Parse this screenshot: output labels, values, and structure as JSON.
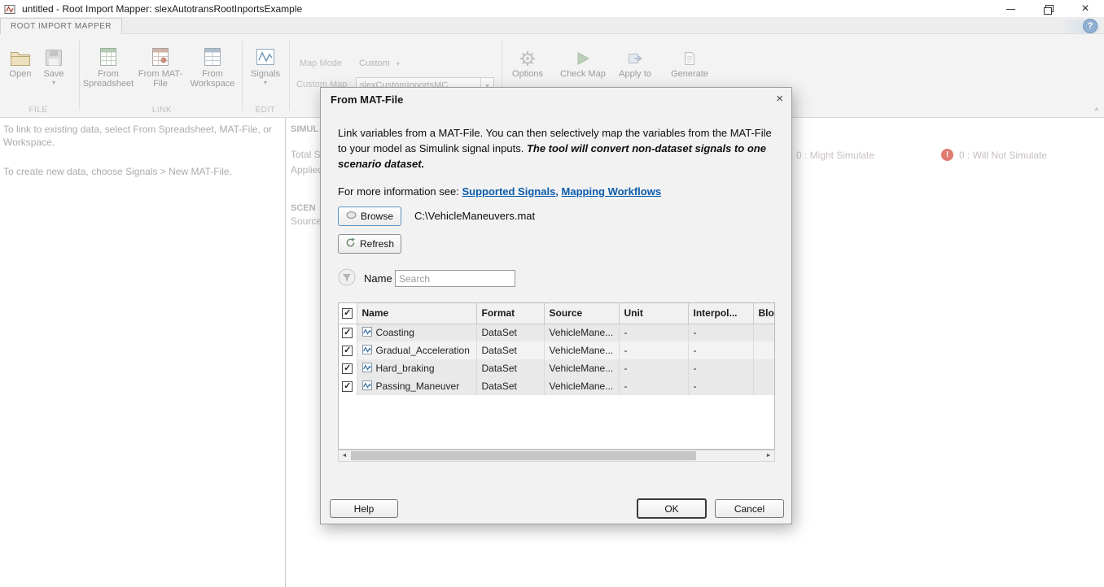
{
  "icons": {
    "caret": "▾",
    "check": "✓",
    "question": "?",
    "close": "×",
    "scroll_left": "◄",
    "scroll_right": "►",
    "chevron_up": "▴",
    "exclamation": "!"
  },
  "colors": {
    "accent_link": "#0b5cad",
    "will_not_simulate_badge": "#e17a70",
    "browse_focus_border": "#5b94c8"
  },
  "window": {
    "title": "untitled - Root Import Mapper: slexAutotransRootInportsExample"
  },
  "ribbon": {
    "tab_label": "ROOT IMPORT MAPPER",
    "file_group": {
      "group_label": "FILE",
      "open_label": "Open",
      "save_label": "Save"
    },
    "link_group": {
      "group_label": "LINK",
      "from_spreadsheet": "From Spreadsheet",
      "from_matfile": "From MAT-File",
      "from_workspace": "From Workspace"
    },
    "edit_group": {
      "group_label": "EDIT",
      "signals_label": "Signals"
    },
    "map_mode": {
      "label": "Map Mode",
      "value": "Custom"
    },
    "custom_map": {
      "label": "Custom Map",
      "value": "slexCustomInportsMC"
    },
    "options_label": "Options",
    "check_map_label": "Check Map",
    "apply_to_label": "Apply to",
    "generate_label": "Generate"
  },
  "instructions": {
    "line1": "To link to existing data, select From Spreadsheet, MAT-File, or Workspace.",
    "line2": "To create new data, choose Signals > New MAT-File."
  },
  "background": {
    "fragments": {
      "simulation": "SIMUL",
      "total": "Total S",
      "applied": "Applied",
      "scenario": "SCEN",
      "source": "Source"
    },
    "status": [
      {
        "text": "0 : Might Simulate"
      },
      {
        "text": "0 : Will Not Simulate"
      }
    ]
  },
  "dialog": {
    "title": "From MAT-File",
    "intro_normal": "Link variables from a MAT-File. You can then selectively map the variables from the MAT-File to your model as Simulink signal inputs. ",
    "intro_emphasis": "The tool will convert non-dataset signals to one scenario dataset.",
    "more_info_label": "For more information see: ",
    "link1": "Supported Signals",
    "link_sep": ", ",
    "link2": "Mapping Workflows",
    "browse_label": "Browse",
    "file_path": "C:\\VehicleManeuvers.mat",
    "refresh_label": "Refresh",
    "name_label": "Name",
    "search_placeholder": "Search",
    "table": {
      "headers": {
        "name": "Name",
        "format": "Format",
        "source": "Source",
        "unit": "Unit",
        "interp": "Interpol...",
        "block": "Bloc"
      },
      "rows": [
        {
          "name": "Coasting",
          "format": "DataSet",
          "source": "VehicleMane...",
          "unit": "-",
          "interp": "-",
          "block": ""
        },
        {
          "name": "Gradual_Acceleration",
          "format": "DataSet",
          "source": "VehicleMane...",
          "unit": "-",
          "interp": "-",
          "block": ""
        },
        {
          "name": "Hard_braking",
          "format": "DataSet",
          "source": "VehicleMane...",
          "unit": "-",
          "interp": "-",
          "block": ""
        },
        {
          "name": "Passing_Maneuver",
          "format": "DataSet",
          "source": "VehicleMane...",
          "unit": "-",
          "interp": "-",
          "block": ""
        }
      ]
    },
    "help_label": "Help",
    "ok_label": "OK",
    "cancel_label": "Cancel"
  }
}
